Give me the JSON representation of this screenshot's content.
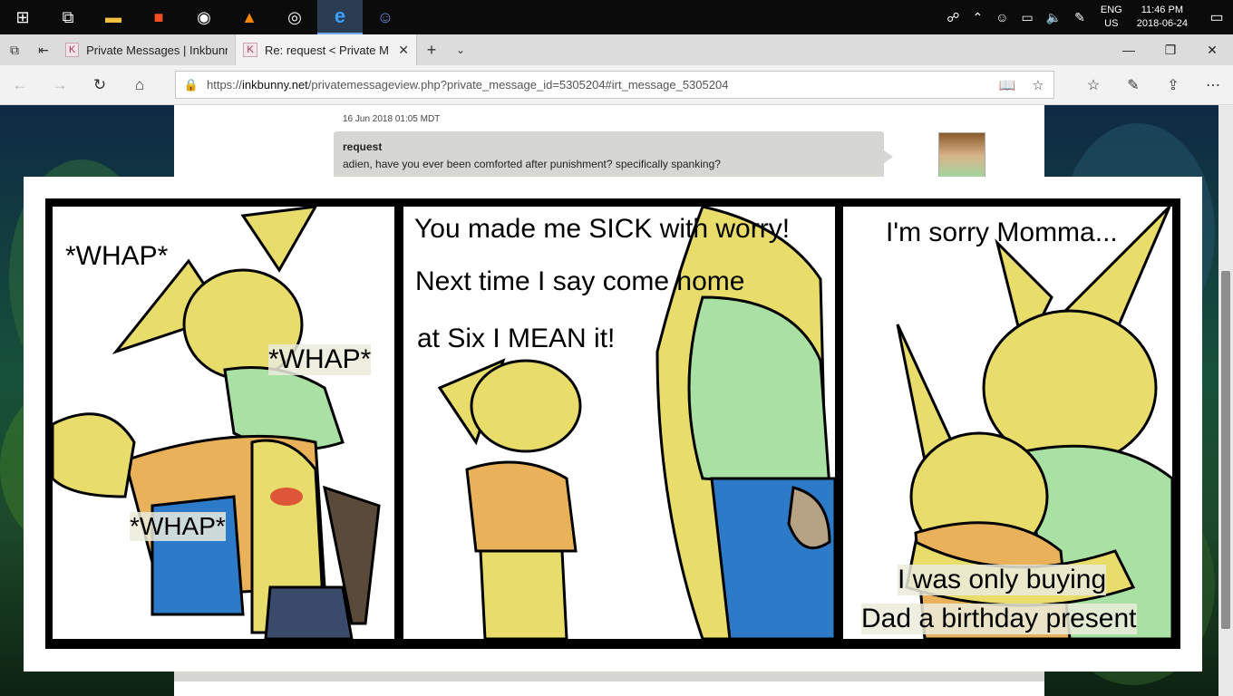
{
  "taskbar": {
    "apps": [
      {
        "name": "windows-start-icon",
        "glyph": "⊞"
      },
      {
        "name": "task-view-icon",
        "glyph": "⧉"
      },
      {
        "name": "file-explorer-icon",
        "glyph": "📁"
      },
      {
        "name": "store-icon",
        "glyph": "🛍"
      },
      {
        "name": "obs-icon",
        "glyph": "◉"
      },
      {
        "name": "vlc-icon",
        "glyph": "▲"
      },
      {
        "name": "steam-icon",
        "glyph": "◎"
      },
      {
        "name": "edge-icon",
        "glyph": "e"
      },
      {
        "name": "discord-icon",
        "glyph": "☺"
      }
    ],
    "lang_top": "ENG",
    "lang_bottom": "US",
    "time": "11:46 PM",
    "date": "2018-06-24"
  },
  "tabs": [
    {
      "title": "Private Messages | Inkbunny",
      "fav": "K"
    },
    {
      "title": "Re: request < Private M",
      "fav": "K"
    }
  ],
  "address": {
    "prefix": "https://",
    "domain": "inkbunny.net",
    "path": "/privatemessageview.php?private_message_id=5305204#irt_message_5305204"
  },
  "message": {
    "date": "16 Jun 2018 01:05 MDT",
    "subject": "request",
    "body": "adien, have you ever been comforted after punishment? specifically spanking?"
  },
  "comic": {
    "panel1": {
      "sfx1": "*WHAP*",
      "sfx2": "*WHAP*",
      "sfx3": "*WHAP*"
    },
    "panel2": {
      "line1": "You made me SICK with worry!",
      "line2": "Next time I say come home",
      "line3": "at Six I MEAN it!"
    },
    "panel3": {
      "line1": "I'm sorry Momma...",
      "line2": "I was only buying",
      "line3": "Dad a birthday present"
    }
  },
  "colors": {
    "fur": "#e8dc6a",
    "shirt_green": "#a9e0a4",
    "jeans": "#2d7ac8",
    "shirt_orange": "#e9b25a"
  }
}
